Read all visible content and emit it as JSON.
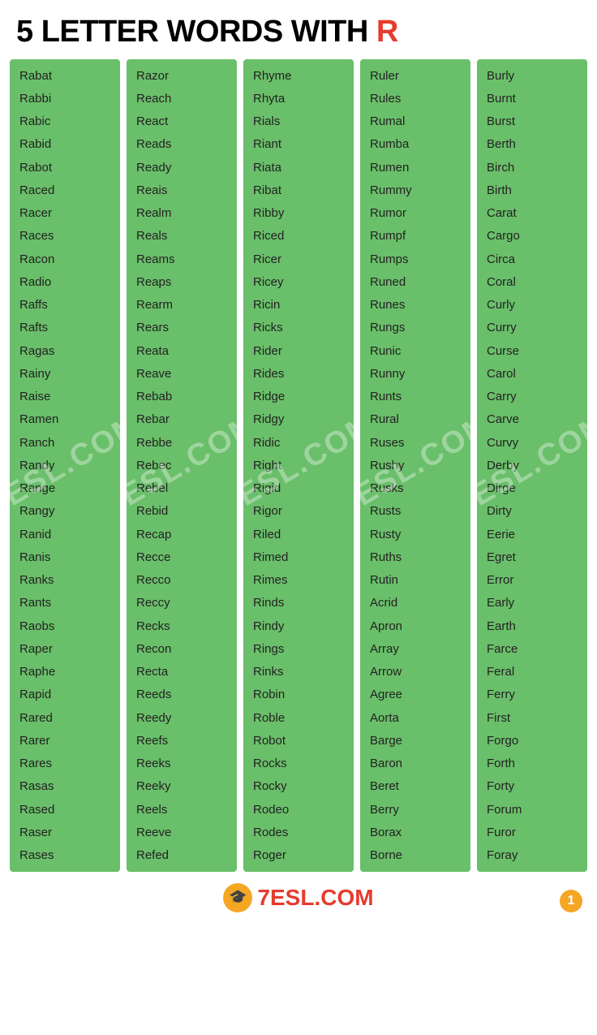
{
  "header": {
    "title_part1": "5 LETTER WORDS WITH ",
    "title_r": "R"
  },
  "columns": [
    {
      "id": "col1",
      "words": [
        "Rabat",
        "Rabbi",
        "Rabic",
        "Rabid",
        "Rabot",
        "Raced",
        "Racer",
        "Races",
        "Racon",
        "Radio",
        "Raffs",
        "Rafts",
        "Ragas",
        "Rainy",
        "Raise",
        "Ramen",
        "Ranch",
        "Randy",
        "Range",
        "Rangy",
        "Ranid",
        "Ranis",
        "Ranks",
        "Rants",
        "Raobs",
        "Raper",
        "Raphe",
        "Rapid",
        "Rared",
        "Rarer",
        "Rares",
        "Rasas",
        "Rased",
        "Raser",
        "Rases"
      ]
    },
    {
      "id": "col2",
      "words": [
        "Razor",
        "Reach",
        "React",
        "Reads",
        "Ready",
        "Reais",
        "Realm",
        "Reals",
        "Reams",
        "Reaps",
        "Rearm",
        "Rears",
        "Reata",
        "Reave",
        "Rebab",
        "Rebar",
        "Rebbe",
        "Rebec",
        "Rebel",
        "Rebid",
        "Recap",
        "Recce",
        "Recco",
        "Reccy",
        "Recks",
        "Recon",
        "Recta",
        "Reeds",
        "Reedy",
        "Reefs",
        "Reeks",
        "Reeky",
        "Reels",
        "Reeve",
        "Refed"
      ]
    },
    {
      "id": "col3",
      "words": [
        "Rhyme",
        "Rhyta",
        "Rials",
        "Riant",
        "Riata",
        "Ribat",
        "Ribby",
        "Riced",
        "Ricer",
        "Ricey",
        "Ricin",
        "Ricks",
        "Rider",
        "Rides",
        "Ridge",
        "Ridgy",
        "Ridic",
        "Right",
        "Rigid",
        "Rigor",
        "Riled",
        "Rimed",
        "Rimes",
        "Rinds",
        "Rindy",
        "Rings",
        "Rinks",
        "Robin",
        "Roble",
        "Robot",
        "Rocks",
        "Rocky",
        "Rodeo",
        "Rodes",
        "Roger"
      ]
    },
    {
      "id": "col4",
      "words": [
        "Ruler",
        "Rules",
        "Rumal",
        "Rumba",
        "Rumen",
        "Rummy",
        "Rumor",
        "Rumpf",
        "Rumps",
        "Runed",
        "Runes",
        "Rungs",
        "Runic",
        "Runny",
        "Runts",
        "Rural",
        "Ruses",
        "Rushy",
        "Rusks",
        "Rusts",
        "Rusty",
        "Ruths",
        "Rutin",
        "Acrid",
        "Apron",
        "Array",
        "Arrow",
        "Agree",
        "Aorta",
        "Barge",
        "Baron",
        "Beret",
        "Berry",
        "Borax",
        "Borne"
      ]
    },
    {
      "id": "col5",
      "words": [
        "Burly",
        "Burnt",
        "Burst",
        "Berth",
        "Birch",
        "Birth",
        "Carat",
        "Cargo",
        "Circa",
        "Coral",
        "Curly",
        "Curry",
        "Curse",
        "Carol",
        "Carry",
        "Carve",
        "Curvy",
        "Derby",
        "Dirge",
        "Dirty",
        "Eerie",
        "Egret",
        "Error",
        "Early",
        "Earth",
        "Farce",
        "Feral",
        "Ferry",
        "First",
        "Forgo",
        "Forth",
        "Forty",
        "Forum",
        "Furor",
        "Foray"
      ]
    }
  ],
  "footer": {
    "logo_icon": "🎓",
    "logo_text_part1": "7ESL",
    "logo_text_part2": ".COM",
    "page_number": "1"
  }
}
